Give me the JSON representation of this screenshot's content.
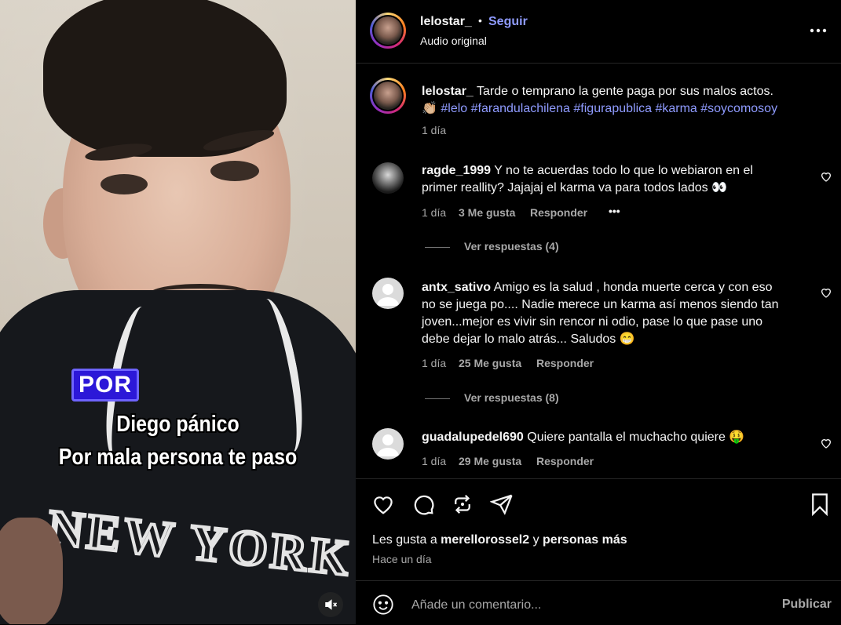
{
  "video": {
    "tag": "POR",
    "caption_line1": "Diego pánico",
    "caption_line2": "Por mala persona te paso",
    "shirt_text": "NEW YORK",
    "mute_icon": "volume-mute-icon"
  },
  "header": {
    "username": "lelostar_",
    "dot": "•",
    "follow_label": "Seguir",
    "subtitle": "Audio original",
    "more_icon": "more-options-icon"
  },
  "post": {
    "username": "lelostar_",
    "text": "Tarde o temprano la gente paga por sus malos actos.",
    "emoji": "👏🏼",
    "hashtags": "#lelo #farandulachilena #figurapublica #karma #soycomosoy",
    "time": "1 día"
  },
  "comments": [
    {
      "username": "ragde_1999",
      "line1": "Y no te acuerdas todo lo que lo webiaron en el",
      "line2": "primer reallity? Jajajaj el karma va para todos lados 👀",
      "time": "1 día",
      "likes": "3 Me gusta",
      "reply": "Responder",
      "more": "•••",
      "view_replies": "Ver respuestas (4)"
    },
    {
      "username": "antx_sativo",
      "line1": "Amigo es la salud , honda muerte cerca y con eso",
      "line2": "no se juega po.... Nadie merece un karma así menos siendo tan",
      "line3": "joven...mejor es vivir sin rencor ni odio, pase lo que pase uno",
      "line4": "debe dejar lo malo atrás... Saludos 😁",
      "time": "1 día",
      "likes": "25 Me gusta",
      "reply": "Responder",
      "view_replies": "Ver respuestas (8)"
    },
    {
      "username": "guadalupedel690",
      "line1": "Quiere pantalla el muchacho quiere 🤑",
      "time": "1 día",
      "likes": "29 Me gusta",
      "reply": "Responder"
    }
  ],
  "actions": {
    "likes_prefix": "Les gusta a ",
    "likes_user": "merellorossel2",
    "likes_mid": " y ",
    "likes_suffix": "personas más",
    "time": "Hace un día"
  },
  "composer": {
    "placeholder": "Añade un comentario...",
    "publish": "Publicar"
  },
  "colors": {
    "accent": "#8f9bff",
    "background": "#000000",
    "muted": "#a8a8a8",
    "tag_bg": "#2c18d8"
  }
}
